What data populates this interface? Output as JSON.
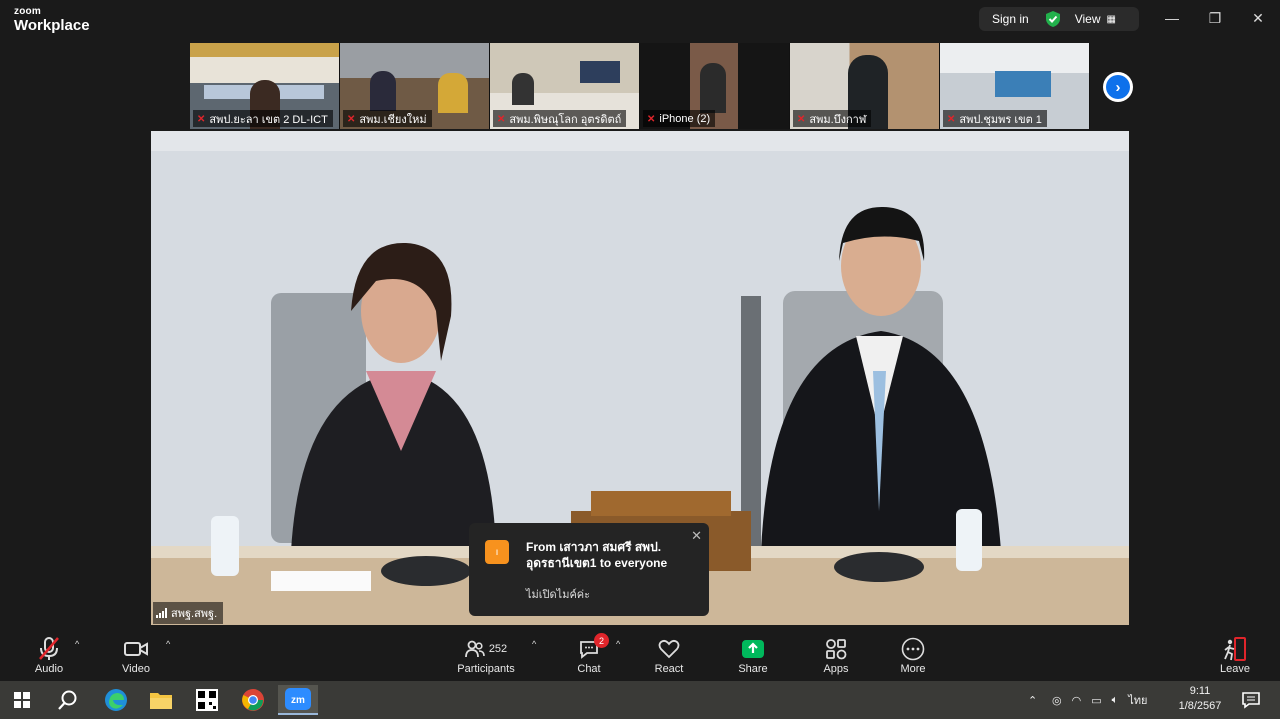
{
  "app": {
    "brand_small": "zoom",
    "brand_large": "Workplace"
  },
  "titlebar": {
    "signin_label": "Sign in",
    "view_label": "View"
  },
  "thumbnails": [
    {
      "label": "สพป.ยะลา เขต 2 DL-ICT"
    },
    {
      "label": "สพม.เชียงใหม่"
    },
    {
      "label": "สพม.พิษณุโลก อุตรดิตถ์"
    },
    {
      "label": "iPhone (2)"
    },
    {
      "label": "สพม.บึงกาฬ"
    },
    {
      "label": "สพป.ชุมพร เขต 1"
    }
  ],
  "main_video": {
    "speaker_name": "สพฐ.สพฐ."
  },
  "chat_popup": {
    "from_text": "From เสาวภา สมศรี สพป. อุดรธานีเขต1 to everyone",
    "message": "ไม่เปิดไมค์ค่ะ"
  },
  "toolbar": {
    "audio_label": "Audio",
    "video_label": "Video",
    "participants_label": "Participants",
    "participants_count": "252",
    "chat_label": "Chat",
    "chat_badge": "2",
    "react_label": "React",
    "share_label": "Share",
    "apps_label": "Apps",
    "more_label": "More",
    "leave_label": "Leave"
  },
  "taskbar": {
    "language": "ไทย",
    "time": "9:11",
    "date": "1/8/2567"
  },
  "colors": {
    "accent_blue": "#0e71eb",
    "share_green": "#00b85c",
    "alert_red": "#e0252b",
    "leave_red": "#e0252b"
  }
}
